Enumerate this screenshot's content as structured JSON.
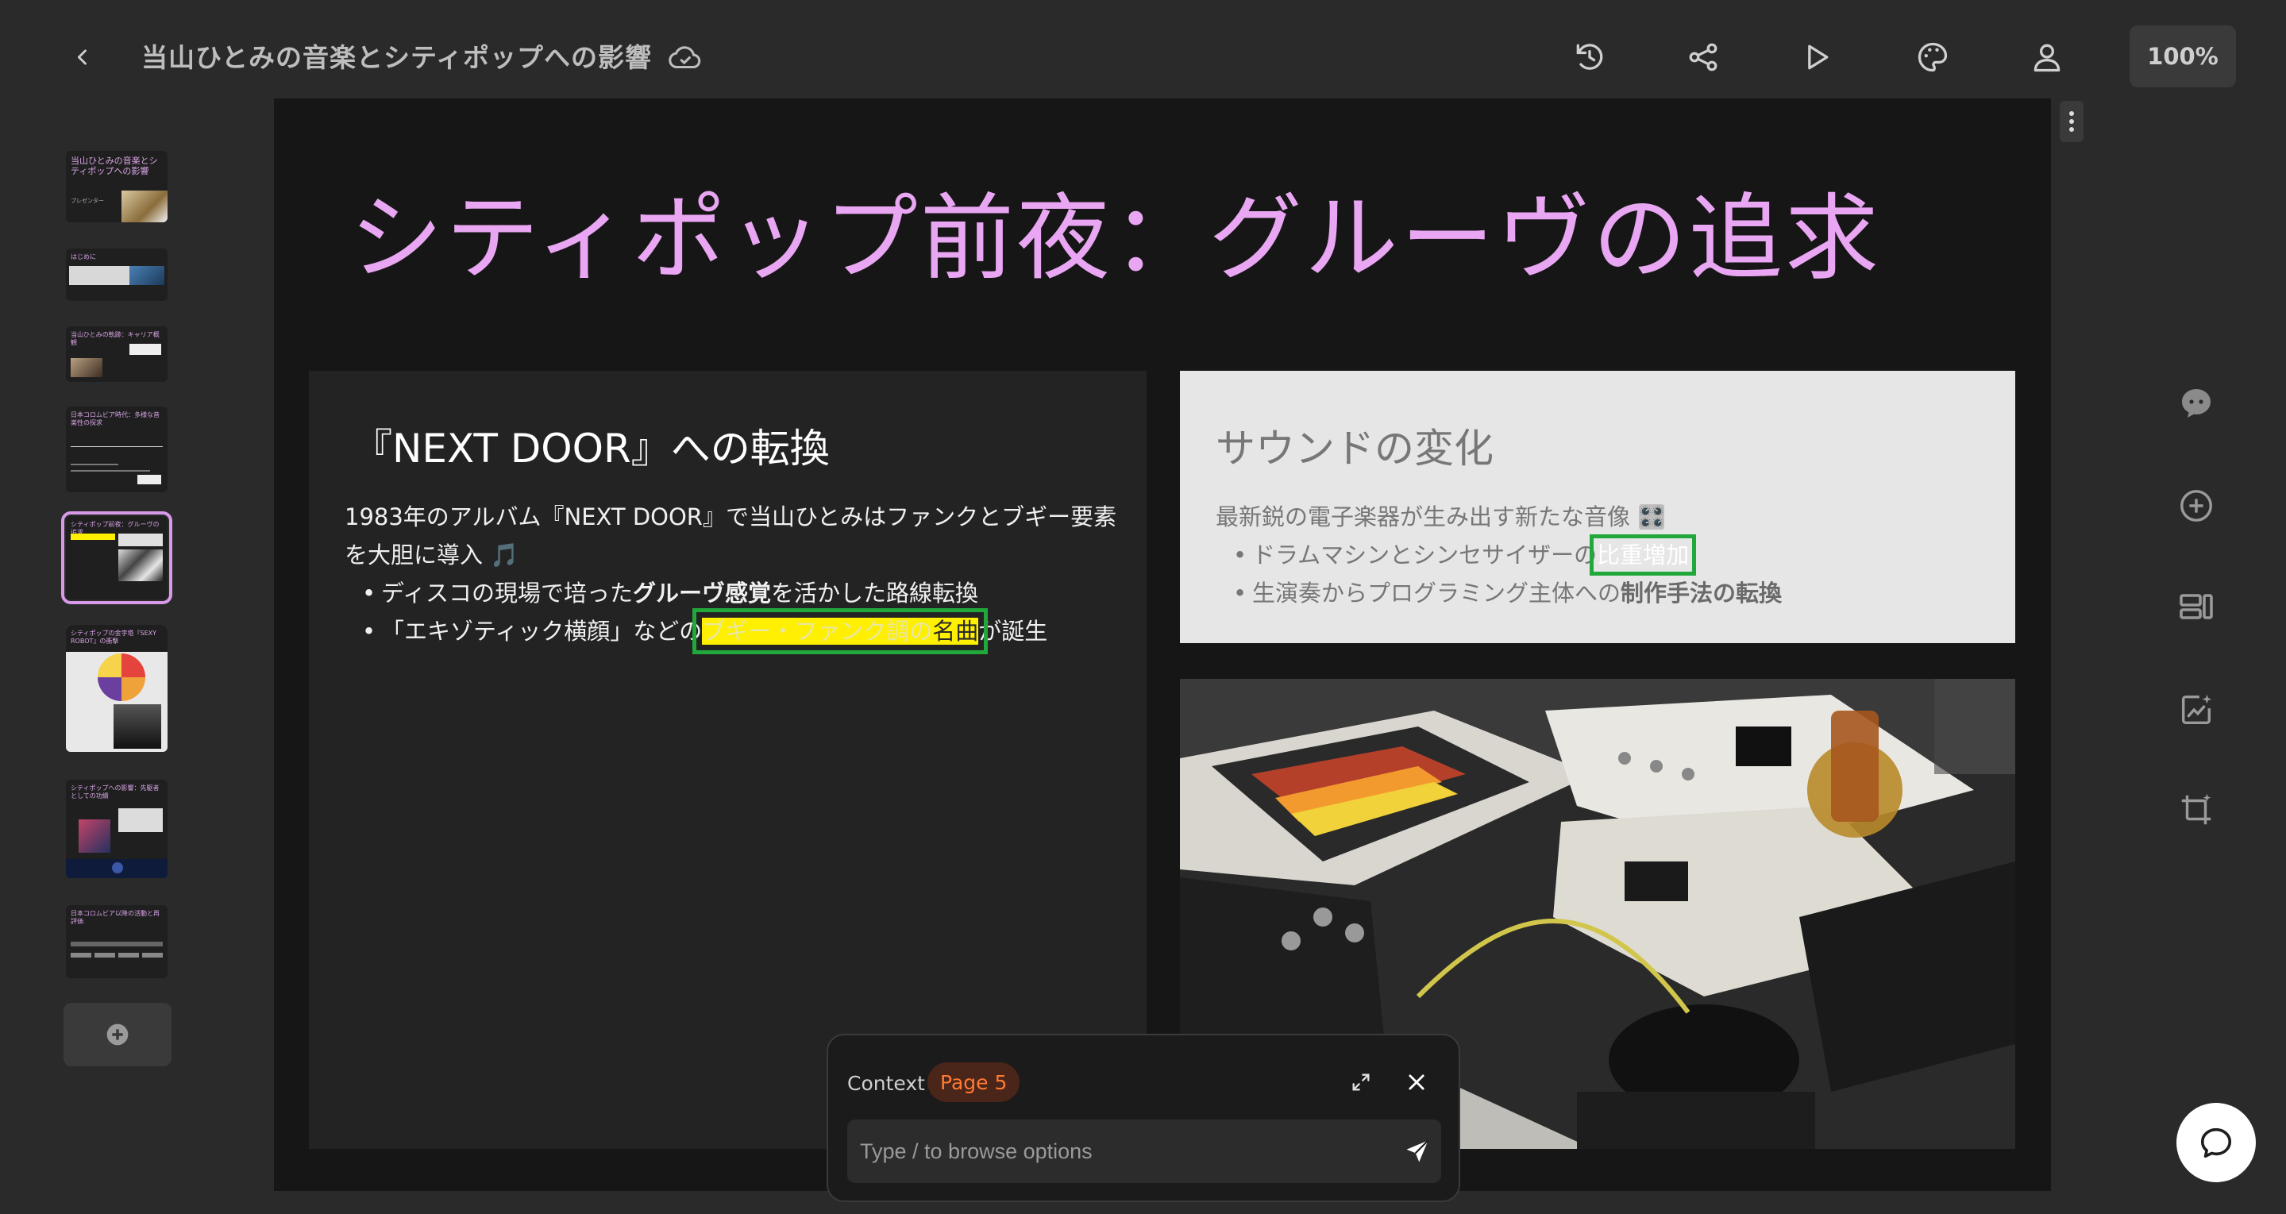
{
  "header": {
    "title": "当山ひとみの音楽とシティポップへの影響",
    "zoom": "100%",
    "icons": [
      "back-icon",
      "cloud-icon",
      "history-icon",
      "share-icon",
      "play-icon",
      "palette-icon",
      "user-icon"
    ]
  },
  "thumbnails": {
    "active_index": 5,
    "items": [
      {
        "title": "当山ひとみの音楽とシティポップへの影響",
        "subtitle": "プレゼンター"
      },
      {
        "title": "はじめに"
      },
      {
        "title": "当山ひとみの軌跡：キャリア概観"
      },
      {
        "title": "日本コロムビア時代：多様な音楽性の探求"
      },
      {
        "title": "シティポップ前夜：グルーヴの追求"
      },
      {
        "title": "シティポップの金字塔『SEXY ROBOT』の衝撃"
      },
      {
        "title": "シティポップへの影響：先駆者としての功績"
      },
      {
        "title": "日本コロムビア以降の活動と再評価"
      }
    ]
  },
  "slide": {
    "title": "シティポップ前夜：グルーヴの追求",
    "left_card": {
      "title": "『NEXT DOOR』への転換",
      "intro": "1983年のアルバム『NEXT DOOR』で当山ひとみはファンクとブギー要素を大胆に導入 🎵",
      "bullet1_pre": "ディスコの現場で培った",
      "bullet1_bold": "グルーヴ感覚",
      "bullet1_post": "を活かした路線転換",
      "bullet2_pre": "「エキゾティック横顔」などの",
      "bullet2_hl": "ブギー・ファンク調の",
      "bullet2_hl_dark": "名曲",
      "bullet2_post": "が誕生"
    },
    "right_card": {
      "title": "サウンドの変化",
      "intro": "最新鋭の電子楽器が生み出す新たな音像 🎛️",
      "bullet1_pre": "ドラムマシンとシンセサイザーの",
      "bullet1_hl": "比重増加",
      "bullet2_pre": "生演奏からプログラミング主体への",
      "bullet2_bold": "制作手法の転換"
    },
    "photo_alt": "Roland TR-808 drum machine and synthesizers on a table"
  },
  "right_tools": [
    "ai-chat-icon",
    "add-element-icon",
    "layout-icon",
    "chart-magic-icon",
    "crop-magic-icon"
  ],
  "context_panel": {
    "label": "Context",
    "page_badge": "Page 5",
    "input_placeholder": "Type / to browse options"
  }
}
